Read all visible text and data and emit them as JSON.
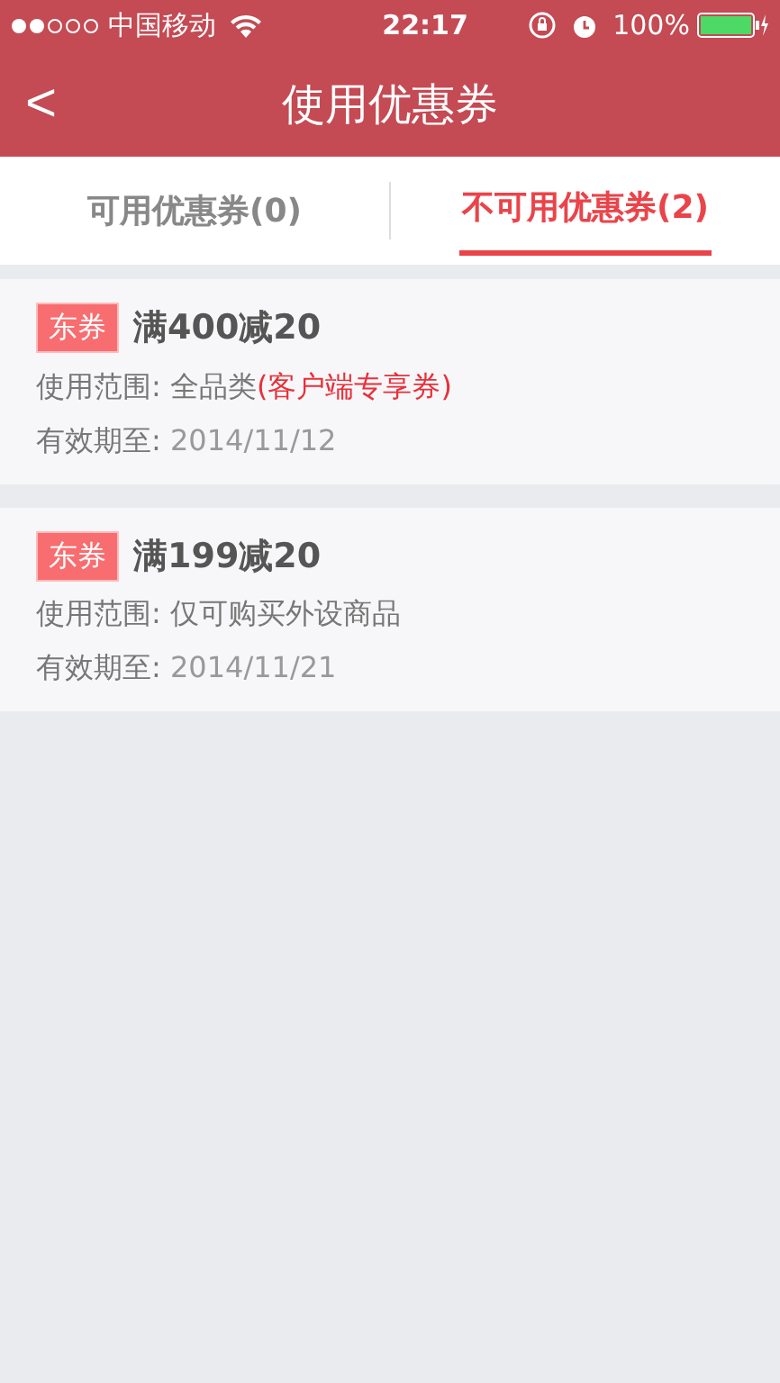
{
  "status_bar": {
    "carrier": "中国移动",
    "time": "22:17",
    "battery": "100%"
  },
  "nav": {
    "back": "<",
    "title": "使用优惠券"
  },
  "tabs": [
    {
      "label": "可用优惠券(0)",
      "selected": false
    },
    {
      "label": "不可用优惠券(2)",
      "selected": true
    }
  ],
  "coupons": [
    {
      "tag": "东券",
      "title": "满400减20",
      "scope_label": "使用范围:",
      "scope": "全品类",
      "scope_note": "(客户端专享券)",
      "expiry_label": "有效期至:",
      "expiry": "2014/11/12"
    },
    {
      "tag": "东券",
      "title": "满199减20",
      "scope_label": "使用范围:",
      "scope": "仅可购买外设商品",
      "expiry_label": "有效期至:",
      "expiry": "2014/11/21"
    }
  ]
}
